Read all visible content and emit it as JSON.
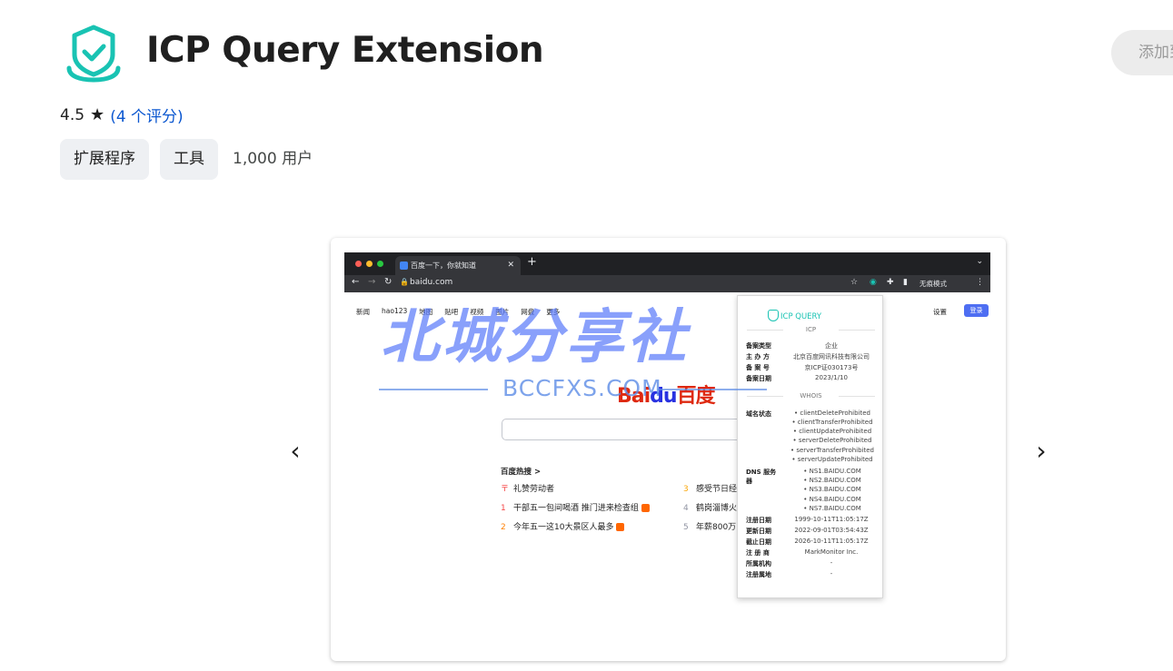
{
  "header": {
    "title": "ICP Query Extension",
    "add_button": "添加到",
    "rating": "4.5",
    "rating_count": "(4 个评分)",
    "chips": [
      "扩展程序",
      "工具"
    ],
    "users": "1,000 用户"
  },
  "colors": {
    "accent": "#19c3b3",
    "link": "#0b57d0",
    "watermark": "#5c7cfa"
  },
  "carousel": {
    "prev": "‹",
    "next": "›"
  },
  "screenshot": {
    "tab_title": "百度一下，你就知道",
    "url": "baidu.com",
    "incognito": "无痕模式",
    "nav_links": [
      "新闻",
      "hao123",
      "地图",
      "贴吧",
      "视频",
      "图片",
      "网盘",
      "更多"
    ],
    "settings": "设置",
    "login": "登录",
    "logo_left": "Bai",
    "logo_du": "du",
    "logo_right": "百度",
    "hot_title": "百度热搜 >",
    "hot_left": [
      {
        "n": "〒",
        "text": "礼赞劳动者"
      },
      {
        "n": "1",
        "text": "干部五一包间喝酒 推门进来检查组"
      },
      {
        "n": "2",
        "text": "今年五一这10大景区人最多"
      }
    ],
    "hot_right": [
      {
        "n": "3",
        "text": "感受节日经"
      },
      {
        "n": "4",
        "text": "鹤岗淄博火"
      },
      {
        "n": "5",
        "text": "年薪800万"
      }
    ],
    "watermark_big": "北城分享社",
    "watermark_small": "BCCFXS.COM"
  },
  "popup": {
    "title": "ICP QUERY",
    "icp_section": "ICP",
    "icp": [
      {
        "k": "备案类型",
        "v": "企业"
      },
      {
        "k": "主 办 方",
        "v": "北京百度网讯科技有限公司"
      },
      {
        "k": "备 案 号",
        "v": "京ICP证030173号"
      },
      {
        "k": "备案日期",
        "v": "2023/1/10"
      }
    ],
    "whois_section": "WHOIS",
    "domain_status_label": "域名状态",
    "domain_status": [
      "clientDeleteProhibited",
      "clientTransferProhibited",
      "clientUpdateProhibited",
      "serverDeleteProhibited",
      "serverTransferProhibited",
      "serverUpdateProhibited"
    ],
    "dns_label": "DNS 服务器",
    "dns": [
      "NS1.BAIDU.COM",
      "NS2.BAIDU.COM",
      "NS3.BAIDU.COM",
      "NS4.BAIDU.COM",
      "NS7.BAIDU.COM"
    ],
    "whois": [
      {
        "k": "注册日期",
        "v": "1999-10-11T11:05:17Z"
      },
      {
        "k": "更新日期",
        "v": "2022-09-01T03:54:43Z"
      },
      {
        "k": "截止日期",
        "v": "2026-10-11T11:05:17Z"
      },
      {
        "k": "注 册 商",
        "v": "MarkMonitor Inc."
      },
      {
        "k": "所属机构",
        "v": "-"
      },
      {
        "k": "注册属地",
        "v": "-"
      }
    ]
  }
}
